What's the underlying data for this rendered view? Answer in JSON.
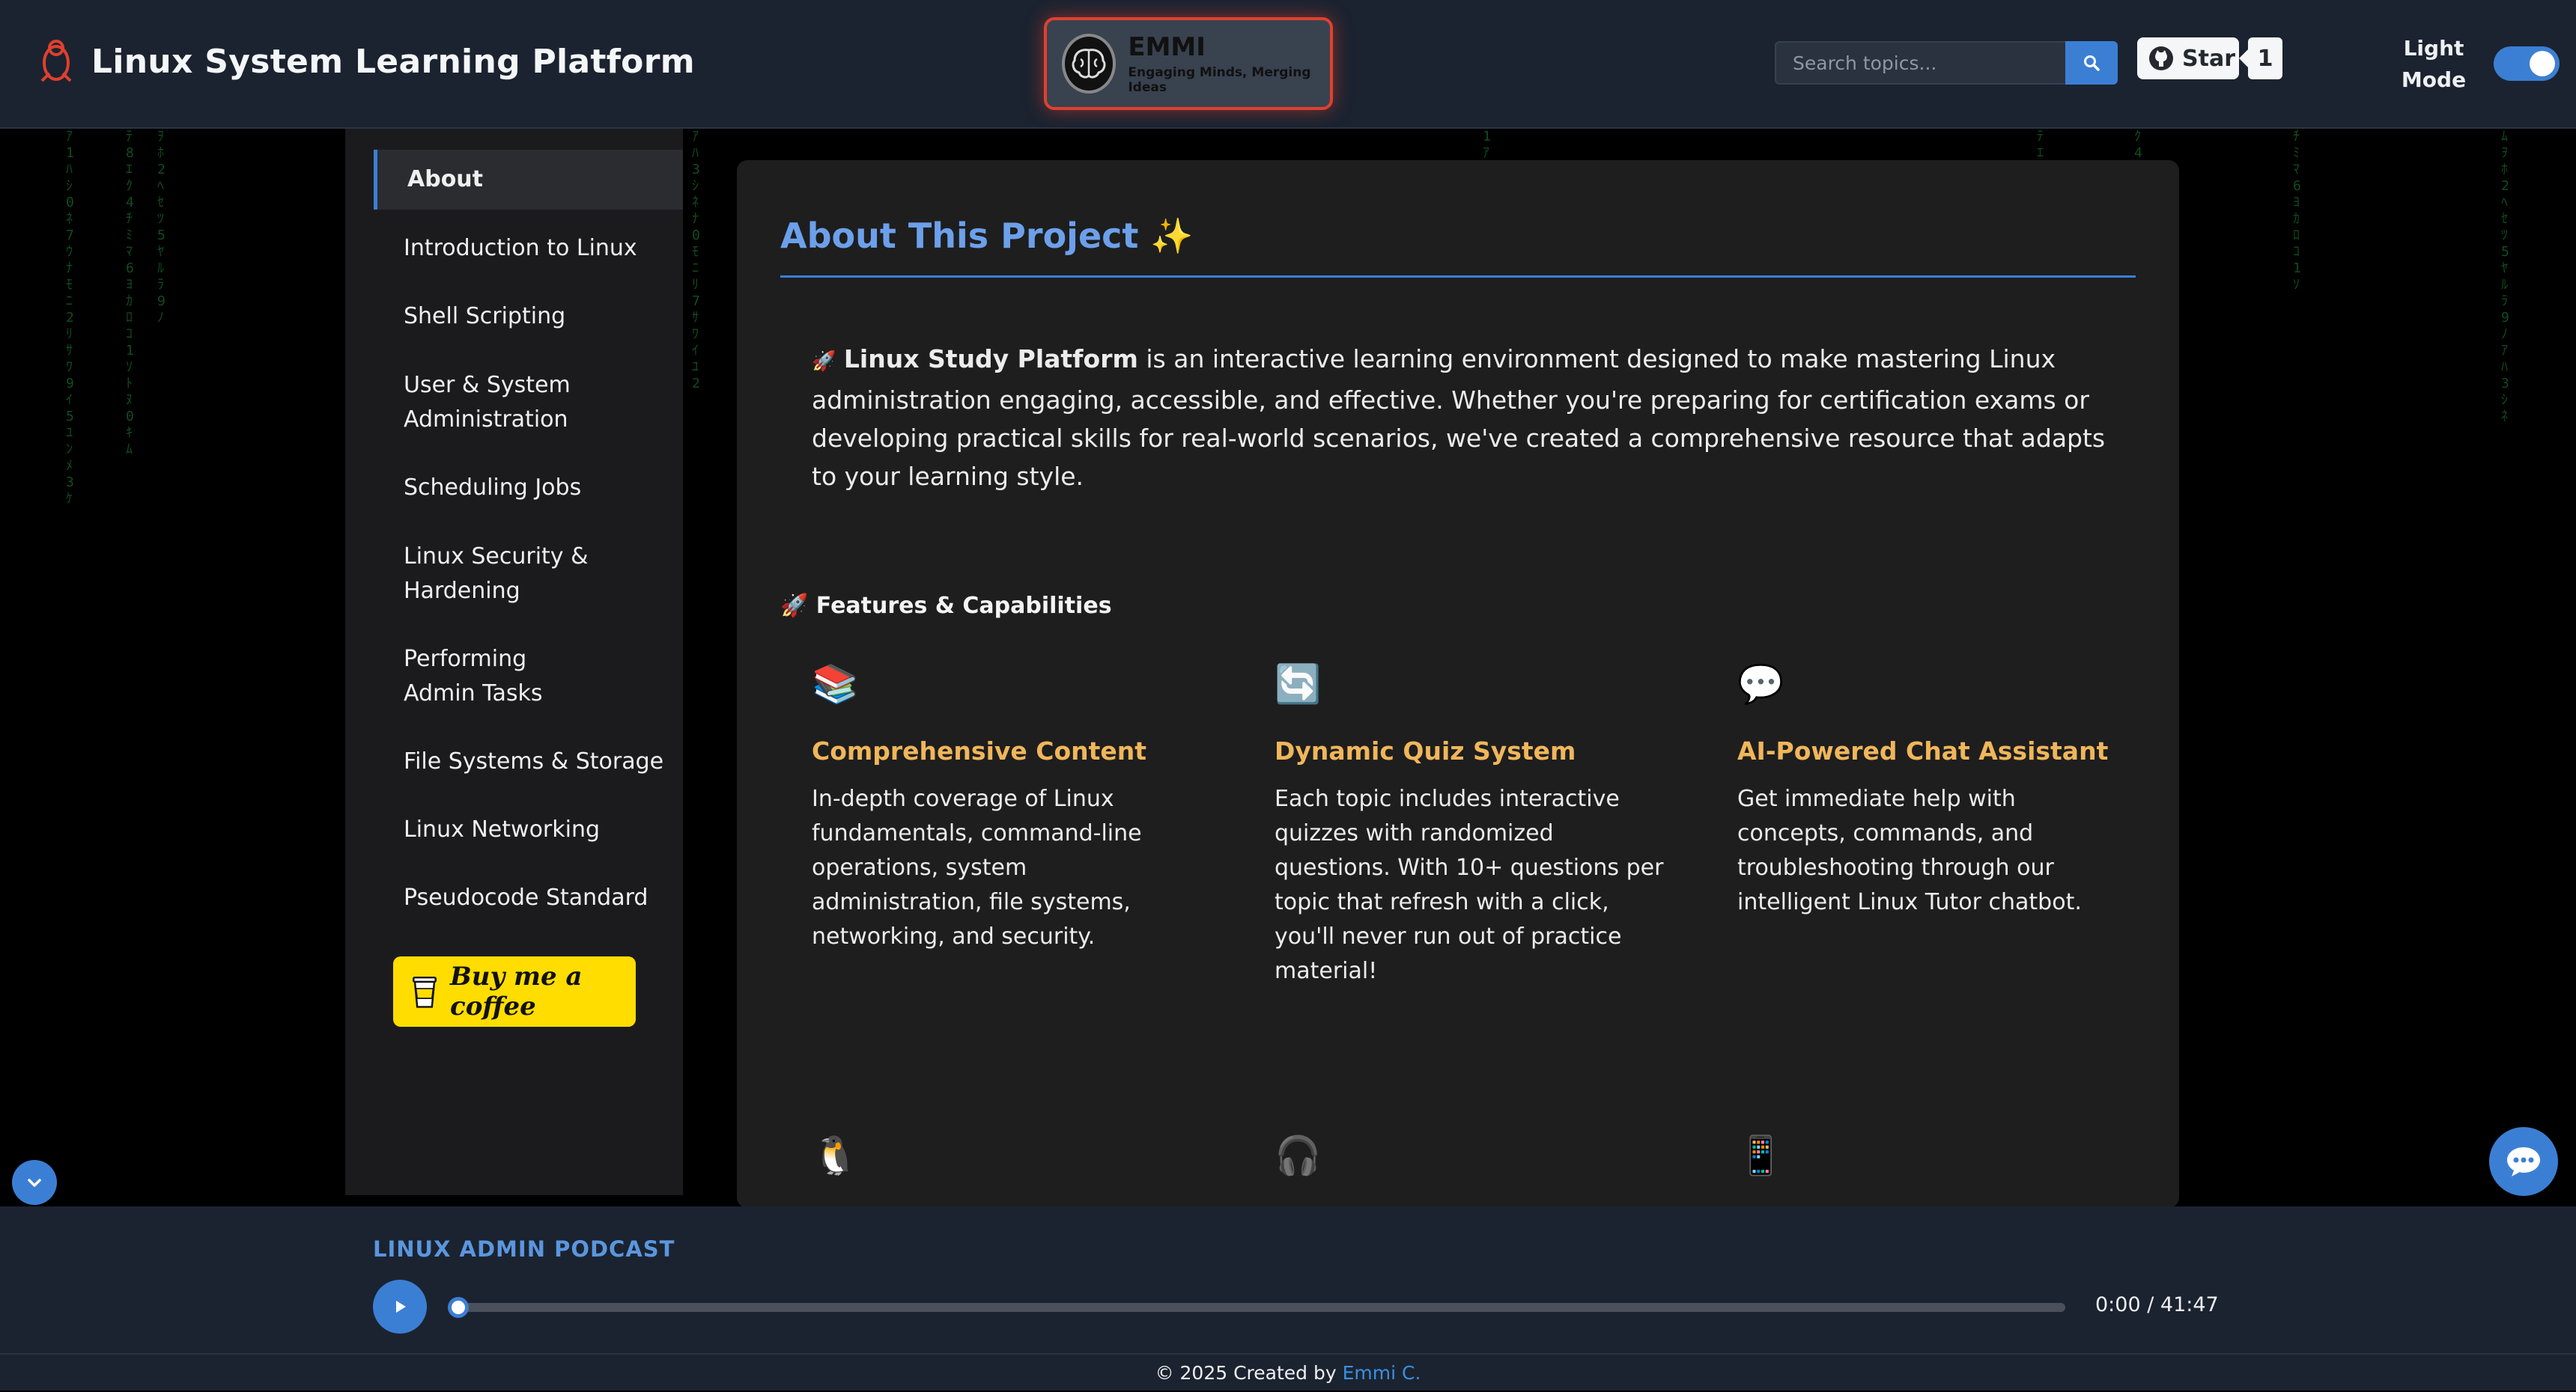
{
  "header": {
    "title": "Linux System Learning Platform",
    "logo_name": "EMMI",
    "logo_tagline": "Engaging Minds, Merging Ideas",
    "search_placeholder": "Search topics...",
    "github_star_label": "Star",
    "github_star_count": "1",
    "mode_label_line1": "Light",
    "mode_label_line2": "Mode"
  },
  "sidebar": {
    "items": [
      {
        "label": "About",
        "active": true
      },
      {
        "label": "Introduction to Linux"
      },
      {
        "label": "Shell Scripting"
      },
      {
        "label": "User & System Administration"
      },
      {
        "label": "Scheduling Jobs"
      },
      {
        "label": "Linux Security & Hardening"
      },
      {
        "label": "Performing Admin Tasks"
      },
      {
        "label": "File Systems & Storage"
      },
      {
        "label": "Linux Networking"
      },
      {
        "label": "Pseudocode Standard"
      }
    ],
    "buy_coffee_label": "Buy me a coffee"
  },
  "main": {
    "title": "About This Project ✨",
    "intro_icon": "🚀",
    "intro_bold": "Linux Study Platform",
    "intro_text": " is an interactive learning environment designed to make mastering Linux administration engaging, accessible, and effective. Whether you're preparing for certification exams or developing practical skills for real-world scenarios, we've created a comprehensive resource that adapts to your learning style.",
    "features_heading": "🚀 Features & Capabilities",
    "features": [
      {
        "icon": "📚",
        "title": "Comprehensive Content",
        "desc": "In-depth coverage of Linux fundamentals, command-line operations, system administration, file systems, networking, and security."
      },
      {
        "icon": "🔄",
        "title": "Dynamic Quiz System",
        "desc": "Each topic includes interactive quizzes with randomized questions. With 10+ questions per topic that refresh with a click, you'll never run out of practice material!"
      },
      {
        "icon": "💬",
        "title": "AI-Powered Chat Assistant",
        "desc": "Get immediate help with concepts, commands, and troubleshooting through our intelligent Linux Tutor chatbot."
      }
    ],
    "second_row_icons": [
      "🐧",
      "🎧",
      "📱"
    ]
  },
  "podcast": {
    "title": "LINUX ADMIN PODCAST",
    "time": "0:00 / 41:47",
    "progress": 0
  },
  "footer": {
    "text": "© 2025 Created by ",
    "author": "Emmi C."
  },
  "colors": {
    "accent": "#3b7fd4",
    "feature_title": "#f0b65a",
    "header_bg": "#1b2330",
    "logo_border": "#e0402e",
    "coffee_yellow": "#ffdd00"
  }
}
